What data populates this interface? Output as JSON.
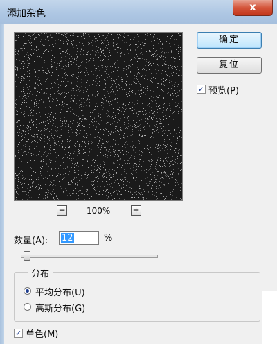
{
  "window": {
    "title": "添加杂色",
    "close_symbol": "x"
  },
  "buttons": {
    "ok_label": "确定",
    "reset_label": "复位"
  },
  "preview_option": {
    "label": "预览(P)",
    "checked": true
  },
  "zoom": {
    "minus": "−",
    "plus": "+",
    "level": "100%"
  },
  "amount": {
    "label": "数量(A):",
    "value": "12",
    "unit": "%",
    "slider_fraction": 0.03
  },
  "distribution": {
    "group_label": "分布",
    "options": [
      {
        "label": "平均分布(U)",
        "selected": true
      },
      {
        "label": "高斯分布(G)",
        "selected": false
      }
    ]
  },
  "monochrome": {
    "label": "单色(M)",
    "checked": true
  },
  "colors": {
    "preview_bg": "#1a1a1a",
    "close_button": "#c2361b",
    "titlebar": "#adc6e3",
    "selection": "#3399ff"
  }
}
